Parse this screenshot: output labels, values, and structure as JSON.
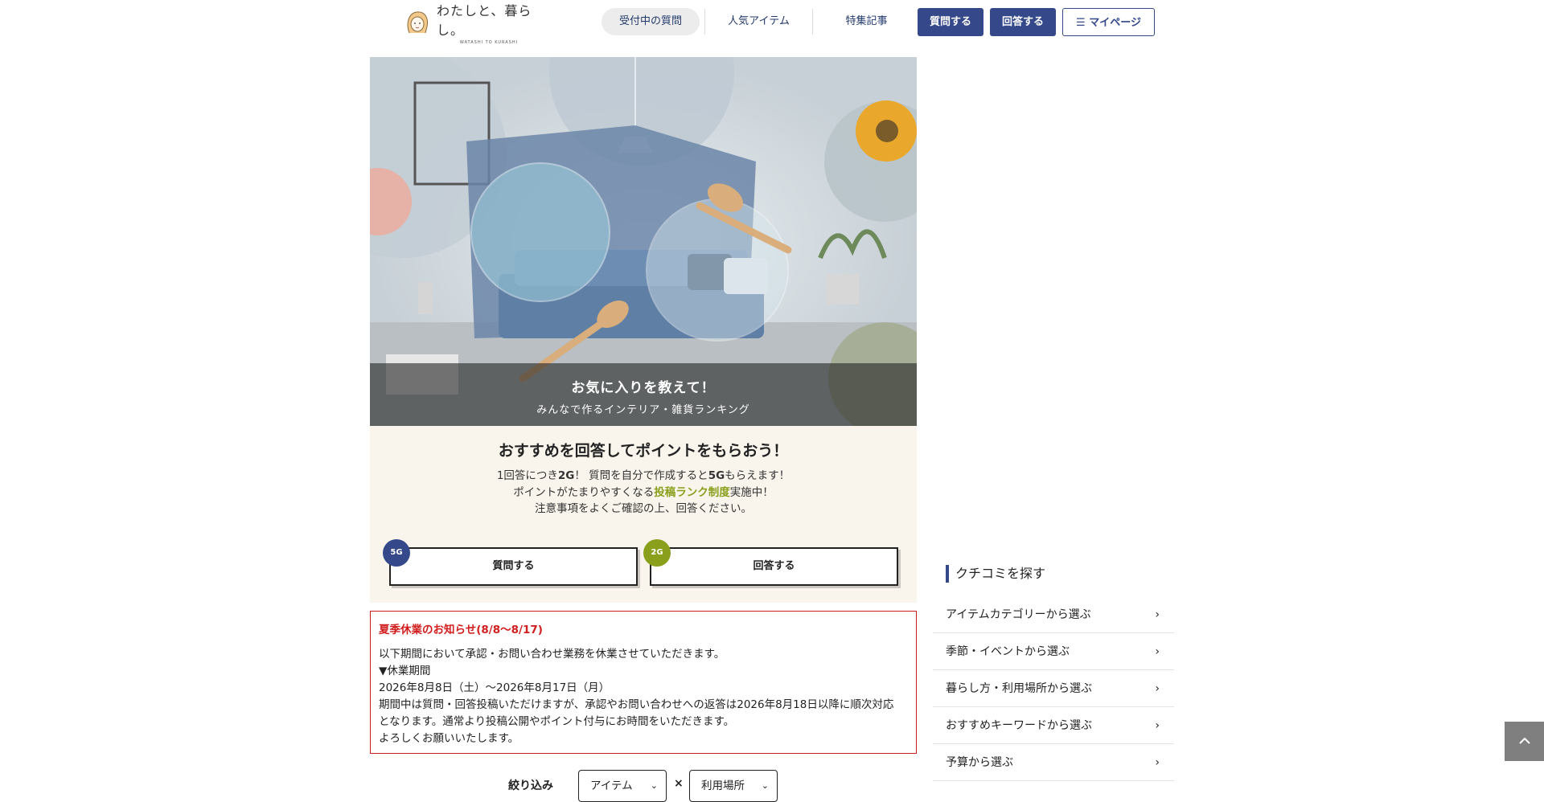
{
  "header": {
    "logo": {
      "main": "わたしと、暮らし。",
      "sub": "WATASHI TO KURASHI"
    },
    "nav": [
      {
        "label": "受付中の質問",
        "active": true
      },
      {
        "label": "人気アイテム",
        "active": false
      },
      {
        "label": "特集記事",
        "active": false
      }
    ],
    "buttons": {
      "ask": "質問する",
      "answer": "回答する",
      "mypage": "☰ マイページ"
    }
  },
  "hero": {
    "title": "お気に入りを教えて！",
    "subtitle": "みんなで作るインテリア・雑貨ランキング"
  },
  "points": {
    "title": "おすすめを回答してポイントをもらおう！",
    "line1_a": "1回答につき",
    "line1_b": "2G",
    "line1_c": "！ 質問を自分で作成すると",
    "line1_d": "5G",
    "line1_e": "もらえます！",
    "line2_a": "ポイントがたまりやすくなる",
    "line2_link": "投稿ランク制度",
    "line2_b": "実施中！",
    "line3": "注意事項をよくご確認の上、回答ください。",
    "ask": {
      "badge": "5G",
      "label": "質問する"
    },
    "answer": {
      "badge": "2G",
      "label": "回答する"
    }
  },
  "notice": {
    "title": "夏季休業のお知らせ(8/8〜8/17)",
    "lines": [
      "以下期間において承認・お問い合わせ業務を休業させていただきます。",
      "▼休業期間",
      "2026年8月8日（土）〜2026年8月17日（月）",
      "期間中は質問・回答投稿いただけますが、承認やお問い合わせへの返答は2026年8月18日以降に順次対応",
      "となります。通常より投稿公開やポイント付与にお時間をいただきます。",
      "よろしくお願いいたします。"
    ]
  },
  "filter": {
    "label": "絞り込み",
    "item": "アイテム",
    "times": "×",
    "place": "利用場所"
  },
  "sidebar": {
    "title": "クチコミを探す",
    "items": [
      "アイテムカテゴリーから選ぶ",
      "季節・イベントから選ぶ",
      "暮らし方・利用場所から選ぶ",
      "おすすめキーワードから選ぶ",
      "予算から選ぶ"
    ]
  },
  "icons": {
    "chevron": "chevron-right-icon",
    "totop": "chevron-up-icon",
    "menu": "hamburger-icon"
  },
  "colors": {
    "brand": "#34488a",
    "accent_green": "#8aa01c",
    "notice_red": "#d21e1e",
    "points_bg": "#f9f5ec"
  }
}
